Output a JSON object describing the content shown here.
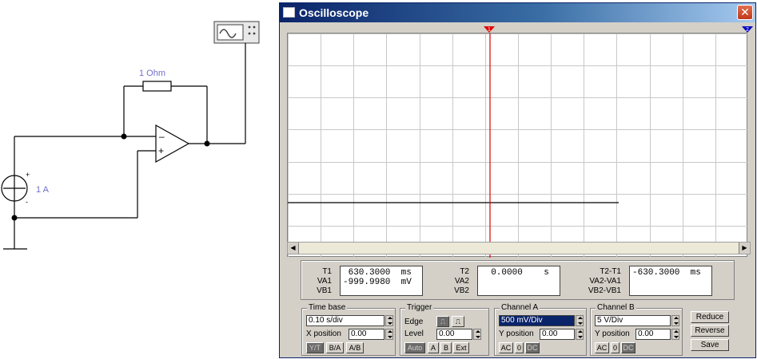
{
  "circuit": {
    "resistor_label": "1 Ohm",
    "source_label": "1 A",
    "opamp_minus": "–",
    "opamp_plus": "+",
    "source_plus": "+",
    "source_minus": "-"
  },
  "window": {
    "title": "Oscilloscope",
    "close_glyph": "✕"
  },
  "cursors": {
    "c1": "1",
    "c2": "2"
  },
  "readout": {
    "t1": {
      "labels": [
        "T1",
        "VA1",
        "VB1"
      ],
      "values": " 630.3000  ms\n-999.9980  mV"
    },
    "t2": {
      "labels": [
        "T2",
        "VA2",
        "VB2"
      ],
      "values": "  0.0000    s"
    },
    "diff": {
      "labels": [
        "T2-T1",
        "VA2-VA1",
        "VB2-VB1"
      ],
      "values": "-630.3000  ms"
    }
  },
  "timebase": {
    "title": "Time base",
    "value": "0.10 s/div",
    "xpos_label": "X position",
    "xpos_value": "0.00",
    "buttons": [
      "Y/T",
      "B/A",
      "A/B"
    ]
  },
  "trigger": {
    "title": "Trigger",
    "edge_label": "Edge",
    "level_label": "Level",
    "level_value": "0.00",
    "buttons": [
      "Auto",
      "A",
      "B",
      "Ext"
    ]
  },
  "channel_a": {
    "title": "Channel A",
    "value": "500 mV/Div",
    "ypos_label": "Y position",
    "ypos_value": "0.00",
    "buttons": [
      "AC",
      "0",
      "DC"
    ]
  },
  "channel_b": {
    "title": "Channel B",
    "value": "5 V/Div",
    "ypos_label": "Y position",
    "ypos_value": "0.00",
    "buttons": [
      "AC",
      "0",
      "DC"
    ]
  },
  "actions": {
    "reduce": "Reduce",
    "reverse": "Reverse",
    "save": "Save"
  },
  "colors": {
    "cursor1": "#e00000",
    "cursor2": "#0000c0",
    "trace": "#000000",
    "title_bar": "#0a246a"
  }
}
